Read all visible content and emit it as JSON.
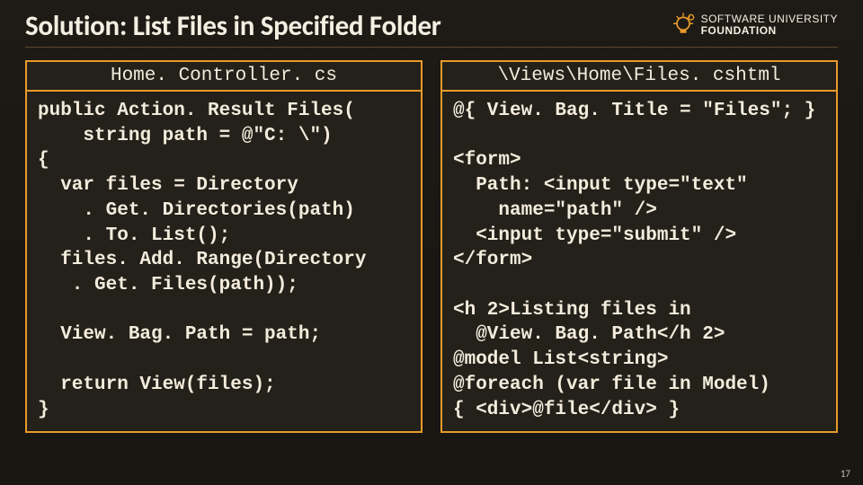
{
  "slide": {
    "title": "Solution: List Files in Specified Folder",
    "page_number": "17"
  },
  "brand": {
    "line1": "SOFTWARE UNIVERSITY",
    "line2": "FOUNDATION",
    "icon": "lightbulb-gear-icon"
  },
  "left": {
    "filename": "Home. Controller. cs",
    "code": "public Action. Result Files(\n    string path = @\"C: \\\")\n{\n  var files = Directory\n    . Get. Directories(path)\n    . To. List();\n  files. Add. Range(Directory\n   . Get. Files(path));\n\n  View. Bag. Path = path;\n\n  return View(files);\n}"
  },
  "right": {
    "filename": "\\Views\\Home\\Files. cshtml",
    "code": "@{ View. Bag. Title = \"Files\"; }\n\n<form>\n  Path: <input type=\"text\"\n    name=\"path\" />\n  <input type=\"submit\" />\n</form>\n\n<h 2>Listing files in\n  @View. Bag. Path</h 2>\n@model List<string>\n@foreach (var file in Model)\n{ <div>@file</div> }"
  }
}
